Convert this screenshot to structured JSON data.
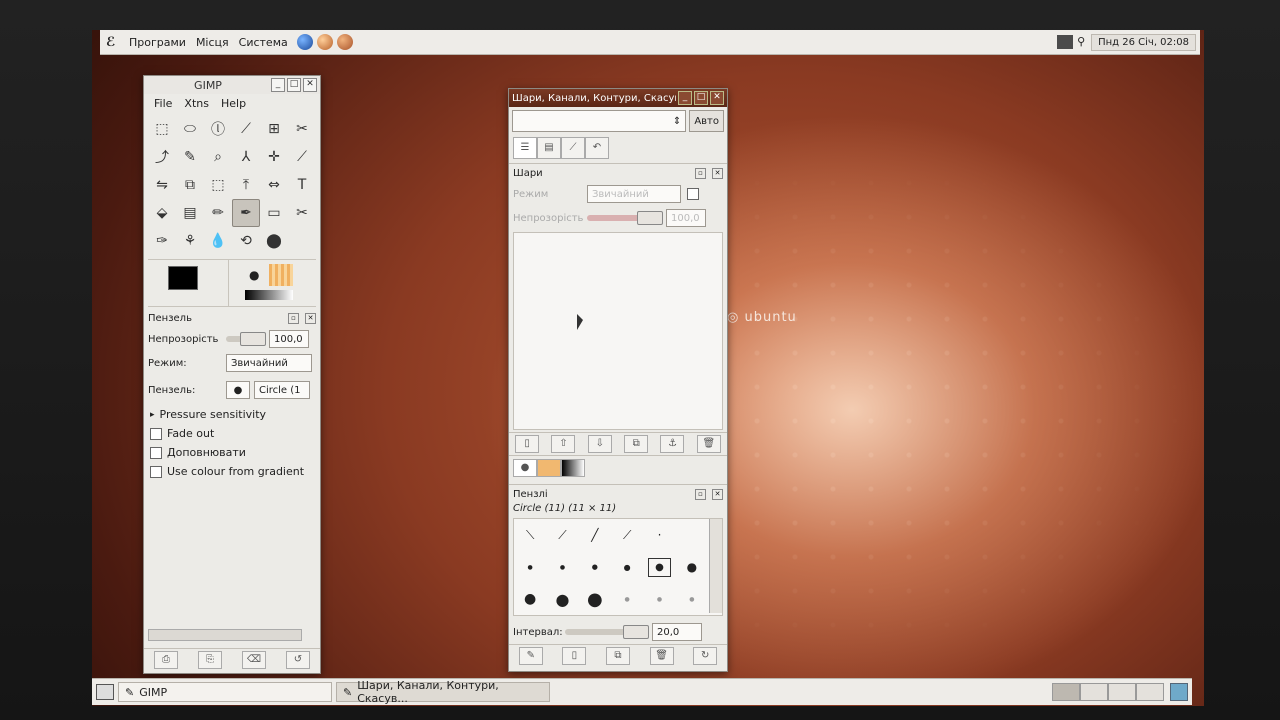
{
  "top_panel": {
    "menus": [
      "Програми",
      "Місця",
      "Система"
    ],
    "clock": "Пнд 26 Січ, 02:08"
  },
  "desktop": {
    "logo_text": "ubuntu"
  },
  "toolbox": {
    "title": "GIMP",
    "menu": [
      "File",
      "Xtns",
      "Help"
    ],
    "tools": [
      "⬚",
      "⬭",
      "ⓛ",
      "⟋",
      "⊞",
      "✂",
      "⤴",
      "✎",
      "⌕",
      "⅄",
      "✛",
      "⟋",
      "⇋",
      "⧉",
      "⬚",
      "⤒",
      "⇔",
      "T",
      "⬙",
      "▤",
      "✏",
      "✒",
      "▭",
      "✂",
      "✑",
      "⚘",
      "💧",
      "⟲",
      "⬤"
    ],
    "tool_options": {
      "header": "Пензель",
      "opacity_label": "Непрозорість",
      "opacity_value": "100,0",
      "mode_label": "Режим:",
      "mode_value": "Звичайний",
      "brush_label": "Пензель:",
      "brush_value": "Circle (1",
      "pressure": "Pressure sensitivity",
      "checkboxes": [
        "Fade out",
        "Доповнювати",
        "Use colour from gradient"
      ]
    }
  },
  "layers_dialog": {
    "title": "Шари, Канали, Контури, Скасув",
    "auto_button": "Авто",
    "layers_header": "Шари",
    "mode_label": "Режим",
    "mode_value": "Звичайний",
    "opacity_label": "Непрозорість",
    "opacity_value": "100,0",
    "brushes_header": "Пензлі",
    "brush_name": "Circle (11) (11 × 11)",
    "interval_label": "Інтервал:",
    "interval_value": "20,0"
  },
  "taskbar": {
    "tasks": [
      "GIMP",
      "Шари, Канали, Контури, Скасув..."
    ]
  }
}
